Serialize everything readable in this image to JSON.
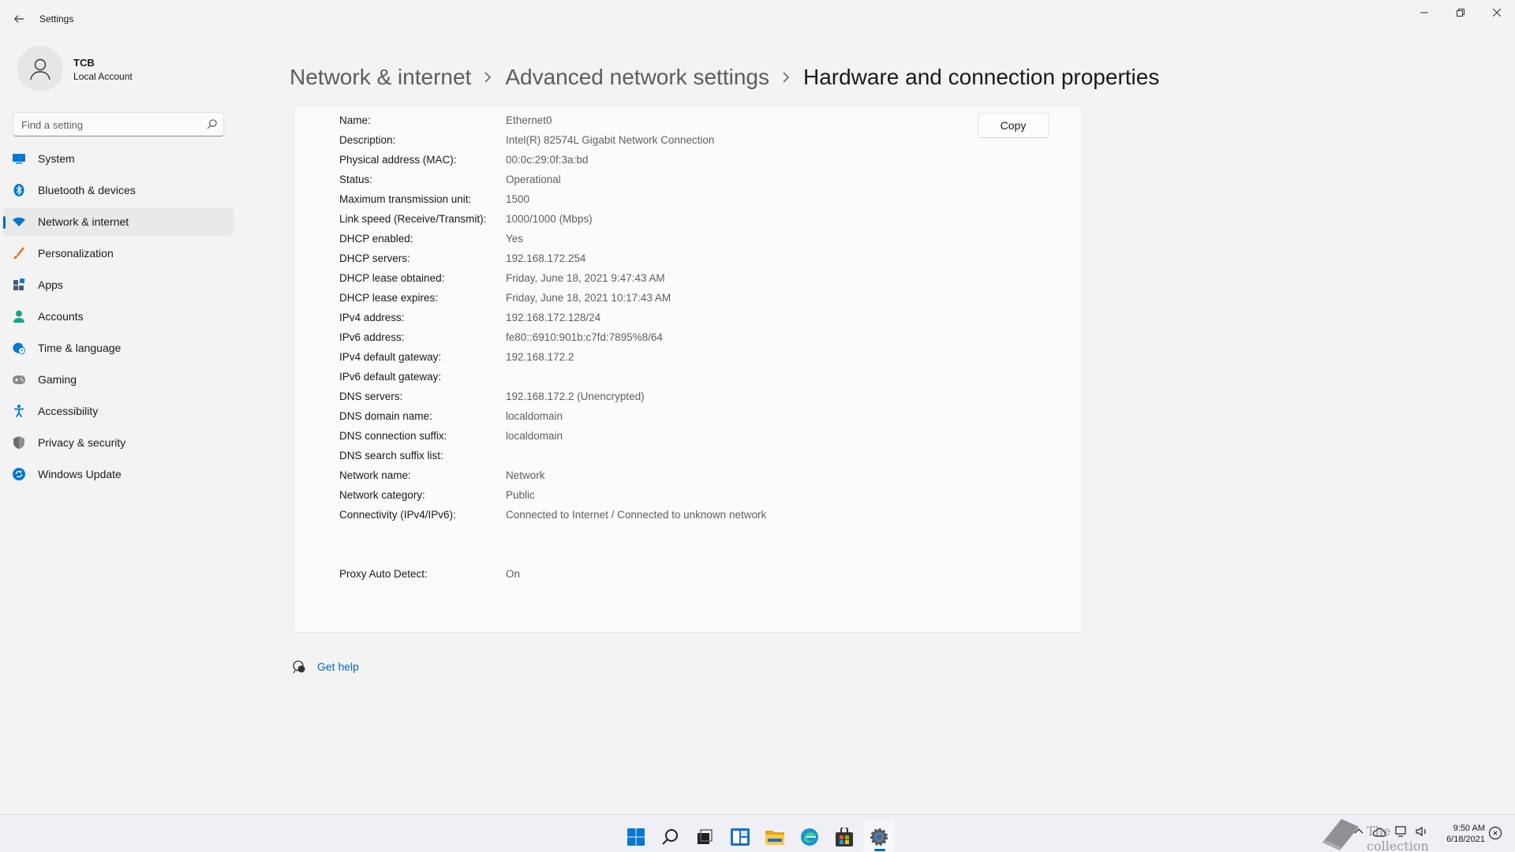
{
  "window": {
    "title": "Settings"
  },
  "profile": {
    "name": "TCB",
    "account_type": "Local Account"
  },
  "search": {
    "placeholder": "Find a setting"
  },
  "nav": [
    {
      "label": "System",
      "icon": "system-icon",
      "color": "#0078d4"
    },
    {
      "label": "Bluetooth & devices",
      "icon": "bluetooth-icon",
      "color": "#0078d4"
    },
    {
      "label": "Network & internet",
      "icon": "wifi-icon",
      "color": "#0078d4",
      "selected": true
    },
    {
      "label": "Personalization",
      "icon": "brush-icon",
      "color": "#e3711c"
    },
    {
      "label": "Apps",
      "icon": "apps-icon",
      "color": "#4a5a72"
    },
    {
      "label": "Accounts",
      "icon": "person-icon",
      "color": "#17a589"
    },
    {
      "label": "Time & language",
      "icon": "globe-clock-icon",
      "color": "#0078d4"
    },
    {
      "label": "Gaming",
      "icon": "gamepad-icon",
      "color": "#8a8a8a"
    },
    {
      "label": "Accessibility",
      "icon": "accessibility-icon",
      "color": "#0078d4"
    },
    {
      "label": "Privacy & security",
      "icon": "shield-icon",
      "color": "#6b6b6b"
    },
    {
      "label": "Windows Update",
      "icon": "update-icon",
      "color": "#0078d4"
    }
  ],
  "breadcrumb": {
    "items": [
      "Network & internet",
      "Advanced network settings"
    ],
    "current": "Hardware and connection properties"
  },
  "copy_button": {
    "label": "Copy"
  },
  "properties": [
    {
      "label": "Name:",
      "value": "Ethernet0"
    },
    {
      "label": "Description:",
      "value": "Intel(R) 82574L Gigabit Network Connection"
    },
    {
      "label": "Physical address (MAC):",
      "value": "00:0c:29:0f:3a:bd"
    },
    {
      "label": "Status:",
      "value": "Operational"
    },
    {
      "label": "Maximum transmission unit:",
      "value": "1500"
    },
    {
      "label": "Link speed (Receive/Transmit):",
      "value": "1000/1000 (Mbps)"
    },
    {
      "label": "DHCP enabled:",
      "value": "Yes"
    },
    {
      "label": "DHCP servers:",
      "value": "192.168.172.254"
    },
    {
      "label": "DHCP lease obtained:",
      "value": "Friday, June 18, 2021 9:47:43 AM"
    },
    {
      "label": "DHCP lease expires:",
      "value": "Friday, June 18, 2021 10:17:43 AM"
    },
    {
      "label": "IPv4 address:",
      "value": "192.168.172.128/24"
    },
    {
      "label": "IPv6 address:",
      "value": "fe80::6910:901b:c7fd:7895%8/64"
    },
    {
      "label": "IPv4 default gateway:",
      "value": "192.168.172.2"
    },
    {
      "label": "IPv6 default gateway:",
      "value": ""
    },
    {
      "label": "DNS servers:",
      "value": "192.168.172.2 (Unencrypted)"
    },
    {
      "label": "DNS domain name:",
      "value": "localdomain"
    },
    {
      "label": "DNS connection suffix:",
      "value": "localdomain"
    },
    {
      "label": "DNS search suffix list:",
      "value": ""
    },
    {
      "label": "Network name:",
      "value": "Network"
    },
    {
      "label": "Network category:",
      "value": "Public"
    },
    {
      "label": "Connectivity (IPv4/IPv6):",
      "value": "Connected to Internet / Connected to unknown network"
    },
    {
      "label": "Proxy Auto Detect:",
      "value": "On"
    }
  ],
  "get_help": {
    "label": "Get help"
  },
  "taskbar": {
    "apps": [
      "start-icon",
      "search-icon",
      "task-view-icon",
      "widgets-icon",
      "file-explorer-icon",
      "edge-icon",
      "store-icon",
      "settings-icon"
    ],
    "active_app": "settings-icon"
  },
  "clock": {
    "time": "9:50 AM",
    "date": "6/18/2021"
  },
  "watermark": {
    "text": "The collection book"
  },
  "colors": {
    "accent": "#0067c0",
    "background": "#f3f3f3",
    "card": "#fbfbfb"
  }
}
